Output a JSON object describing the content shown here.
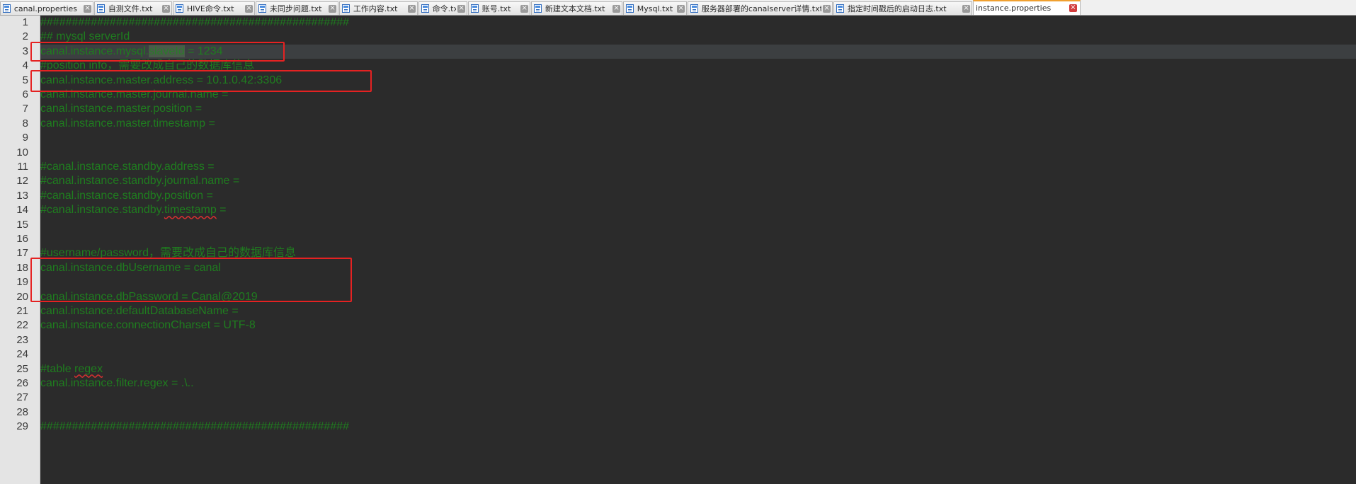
{
  "tabs": [
    {
      "label": "canal.properties",
      "active": false
    },
    {
      "label": "自测文件.txt",
      "active": false
    },
    {
      "label": "HIVE命令.txt",
      "active": false
    },
    {
      "label": "未同步问题.txt",
      "active": false
    },
    {
      "label": "工作内容.txt",
      "active": false
    },
    {
      "label": "命令.txt",
      "active": false
    },
    {
      "label": "账号.txt",
      "active": false
    },
    {
      "label": "新建文本文档.txt",
      "active": false
    },
    {
      "label": "Mysql.txt",
      "active": false
    },
    {
      "label": "服务器部署的canalserver详情.txt",
      "active": false
    },
    {
      "label": "指定时间戳后的启动日志.txt",
      "active": false
    },
    {
      "label": "instance.properties",
      "active": true
    }
  ],
  "close_glyph": "×",
  "editor": {
    "current_line": 3,
    "lines": [
      {
        "num": "1",
        "text": "#################################################"
      },
      {
        "num": "2",
        "text": "## mysql serverId"
      },
      {
        "num": "3",
        "pre": "canal.instance.mysql.",
        "sel": "slaveId",
        "post": " = 1234"
      },
      {
        "num": "4",
        "text": "#position info，需要改成自己的数据库信息"
      },
      {
        "num": "5",
        "text": "canal.instance.master.address = 10.1.0.42:3306"
      },
      {
        "num": "6",
        "text": "canal.instance.master.journal.name ="
      },
      {
        "num": "7",
        "text": "canal.instance.master.position ="
      },
      {
        "num": "8",
        "text": "canal.instance.master.timestamp ="
      },
      {
        "num": "9",
        "text": ""
      },
      {
        "num": "10",
        "text": ""
      },
      {
        "num": "11",
        "text": "#canal.instance.standby.address ="
      },
      {
        "num": "12",
        "text": "#canal.instance.standby.journal.name ="
      },
      {
        "num": "13",
        "text": "#canal.instance.standby.position ="
      },
      {
        "num": "14",
        "pre": "#canal.instance.standby.",
        "squiggle": "timestamp",
        "post": " ="
      },
      {
        "num": "15",
        "text": ""
      },
      {
        "num": "16",
        "text": ""
      },
      {
        "num": "17",
        "text": "#username/password，需要改成自己的数据库信息"
      },
      {
        "num": "18",
        "text": "canal.instance.dbUsername = canal"
      },
      {
        "num": "19",
        "text": ""
      },
      {
        "num": "20",
        "text": "canal.instance.dbPassword = Canal@2019"
      },
      {
        "num": "21",
        "text": "canal.instance.defaultDatabaseName ="
      },
      {
        "num": "22",
        "text": "canal.instance.connectionCharset = UTF-8"
      },
      {
        "num": "23",
        "text": ""
      },
      {
        "num": "24",
        "text": ""
      },
      {
        "num": "25",
        "pre": "#table ",
        "squiggle": "regex",
        "post": ""
      },
      {
        "num": "26",
        "text": "canal.instance.filter.regex = .\\.."
      },
      {
        "num": "27",
        "text": ""
      },
      {
        "num": "28",
        "text": ""
      },
      {
        "num": "29",
        "text": "#################################################"
      }
    ]
  },
  "colors": {
    "code_text": "#1f7d1f",
    "editor_bg": "#2b2b2b",
    "gutter_bg": "#e4e4e4",
    "annotation_box": "#e52222",
    "active_tab_accent": "#f0a030"
  }
}
